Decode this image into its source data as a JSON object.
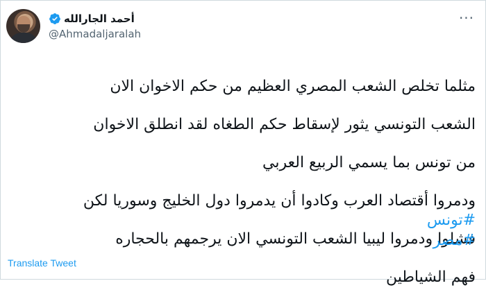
{
  "user": {
    "display_name": "أحمد الجارالله",
    "handle": "@Ahmadaljaralah",
    "verified": true
  },
  "tweet": {
    "lines": [
      "مثلما تخلص الشعب المصري العظيم من حكم الاخوان الان",
      "الشعب التونسي يثور لإسقاط حكم الطغاه لقد انطلق الاخوان",
      "من تونس بما يسمي الربيع العربي",
      "ودمروا أقتصاد العرب وكادوا أن يدمروا دول الخليج وسوريا لكن",
      "فشلوا ودمروا ليبيا الشعب التونسي الان يرجمهم بالحجاره",
      "فهم الشياطين"
    ],
    "hashtags": [
      "#تونس",
      "#مصر"
    ]
  },
  "actions": {
    "translate_label": "Translate Tweet",
    "more_label": "···"
  },
  "colors": {
    "link": "#1d9bf0",
    "verified": "#1d9bf0",
    "secondary_text": "#536471"
  },
  "icons": {
    "verified": "verified-badge-icon",
    "more": "more-options-icon"
  }
}
